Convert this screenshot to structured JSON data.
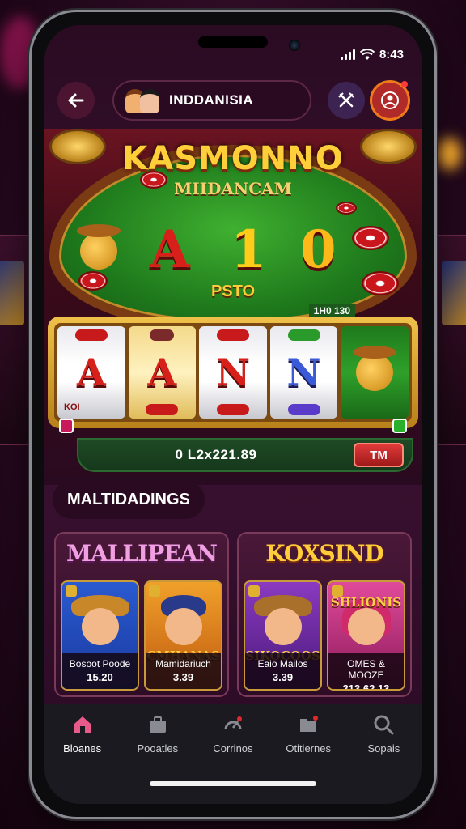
{
  "status_bar": {
    "time": "8:43"
  },
  "header": {
    "region_label": "INDDANISIA",
    "back_icon": "arrow-left-icon",
    "close_icon": "cross-swords-icon",
    "profile_icon": "user-badge-icon"
  },
  "hero": {
    "title": "KASMONNO",
    "subtitle": "MIIDANCAM",
    "symbols": [
      "A",
      "1",
      "0"
    ],
    "middle_text": "PSTO",
    "small_label": "1H0 130",
    "reels": [
      {
        "symbol": "A",
        "color": "#d8201a",
        "caption": "KOI"
      },
      {
        "symbol": "A",
        "color": "#d8201a",
        "caption": ""
      },
      {
        "symbol": "N",
        "color": "#d8201a",
        "caption": ""
      },
      {
        "symbol": "N",
        "color": "#3a5ad8",
        "caption": ""
      },
      {
        "symbol": "",
        "color": "",
        "caption": ""
      }
    ],
    "balance": "0 L2x221.89",
    "action_button": "TM"
  },
  "section": {
    "title": "MALTIDADINGS",
    "cards": [
      {
        "title": "MALLIPEAN",
        "tiles": [
          {
            "name": "",
            "label": "Bosoot Poode",
            "value": "15.20",
            "bg": "#2a5ad0"
          },
          {
            "name": "CMHANAS",
            "label": "Mamidariuch",
            "value": "3.39",
            "bg": "#e07a1a"
          }
        ]
      },
      {
        "title": "KOXSIND",
        "tiles": [
          {
            "name": "SIKOCOOS",
            "label": "Eaio Mailos",
            "value": "3.39",
            "bg": "#7a2ab0"
          },
          {
            "name": "SHLIONIS",
            "label": "OMES & MOOZE",
            "value": "313.62.13",
            "bg": "#c02a8a"
          }
        ]
      }
    ]
  },
  "pagination": {
    "total": 3,
    "active": 0
  },
  "bottom_nav": [
    {
      "label": "Bloanes",
      "icon": "home-icon",
      "active": true
    },
    {
      "label": "Pooatles",
      "icon": "briefcase-icon",
      "active": false
    },
    {
      "label": "Corrinos",
      "icon": "gauge-icon",
      "active": false
    },
    {
      "label": "Otitiernes",
      "icon": "folder-icon",
      "active": false
    },
    {
      "label": "Sopais",
      "icon": "search-icon",
      "active": false
    }
  ],
  "colors": {
    "accent_gold": "#ffcc3a",
    "table_green": "#2fa02a",
    "nav_active": "#e85a8a"
  }
}
